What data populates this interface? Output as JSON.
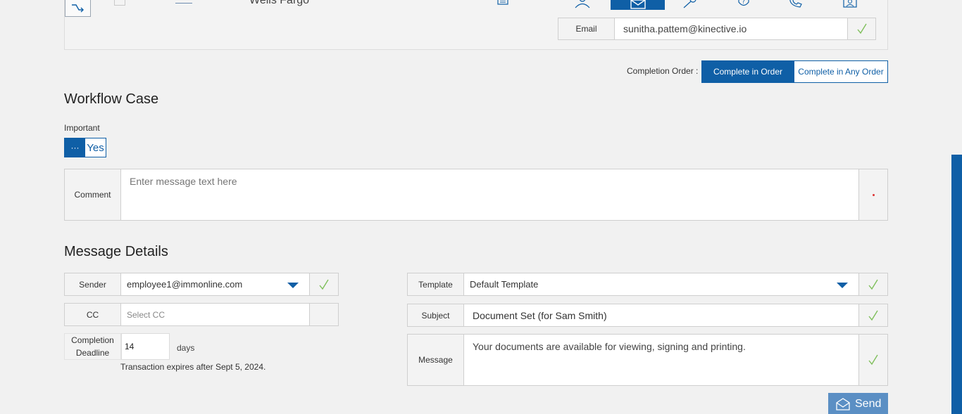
{
  "header": {
    "institution": "Wells Fargo",
    "email_label": "Email",
    "email_value": "sunitha.pattem@kinective.io"
  },
  "completion_order": {
    "label": "Completion Order :",
    "options": [
      "Complete in Order",
      "Complete in Any Order"
    ],
    "selected": "Complete in Order"
  },
  "workflow": {
    "title": "Workflow Case",
    "important_label": "Important",
    "important_toggle_knob": "···",
    "important_value": "Yes",
    "comment_label": "Comment",
    "comment_placeholder": "Enter message text here"
  },
  "message_details": {
    "title": "Message Details",
    "sender_label": "Sender",
    "sender_value": "employee1@immonline.com",
    "cc_label": "CC",
    "cc_placeholder": "Select CC",
    "deadline_label": "Completion Deadline",
    "deadline_value": "14",
    "days_label": "days",
    "expires_text": "Transaction expires after Sept 5, 2024.",
    "template_label": "Template",
    "template_value": "Default Template",
    "subject_label": "Subject",
    "subject_value": "Document Set (for Sam Smith)",
    "message_label": "Message",
    "message_value": "Your documents are available for viewing, signing and printing.",
    "send_label": "Send"
  },
  "icons": [
    "exit-icon",
    "printer-icon",
    "person-icon",
    "mail-icon",
    "key-icon",
    "shield-question-icon",
    "phone-icon",
    "id-card-icon",
    "check-icon",
    "send-mail-icon"
  ]
}
